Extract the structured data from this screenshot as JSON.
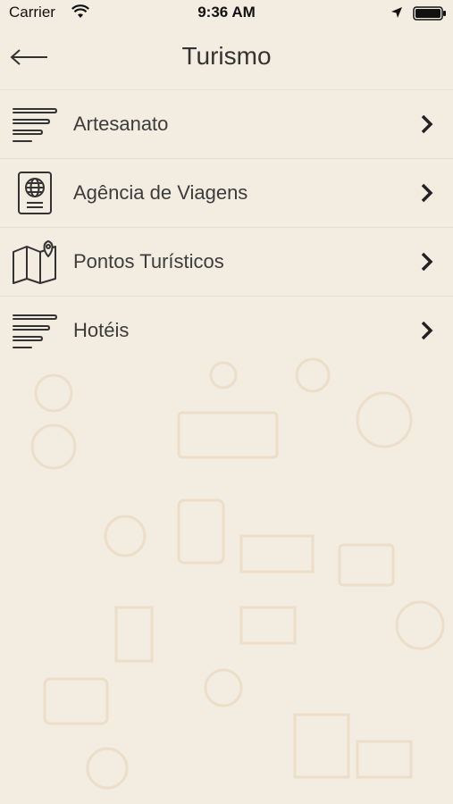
{
  "status_bar": {
    "carrier": "Carrier",
    "time": "9:36 AM"
  },
  "header": {
    "title": "Turismo",
    "back_icon": "arrow-left-icon"
  },
  "menu": {
    "items": [
      {
        "label": "Artesanato",
        "icon": "lines-icon"
      },
      {
        "label": "Agência de Viagens",
        "icon": "passport-icon"
      },
      {
        "label": "Pontos Turísticos",
        "icon": "map-pin-icon"
      },
      {
        "label": "Hotéis",
        "icon": "lines-icon"
      }
    ]
  },
  "colors": {
    "background": "#f3ece0",
    "text": "#3c3c3c",
    "divider": "#e6ddcf"
  }
}
